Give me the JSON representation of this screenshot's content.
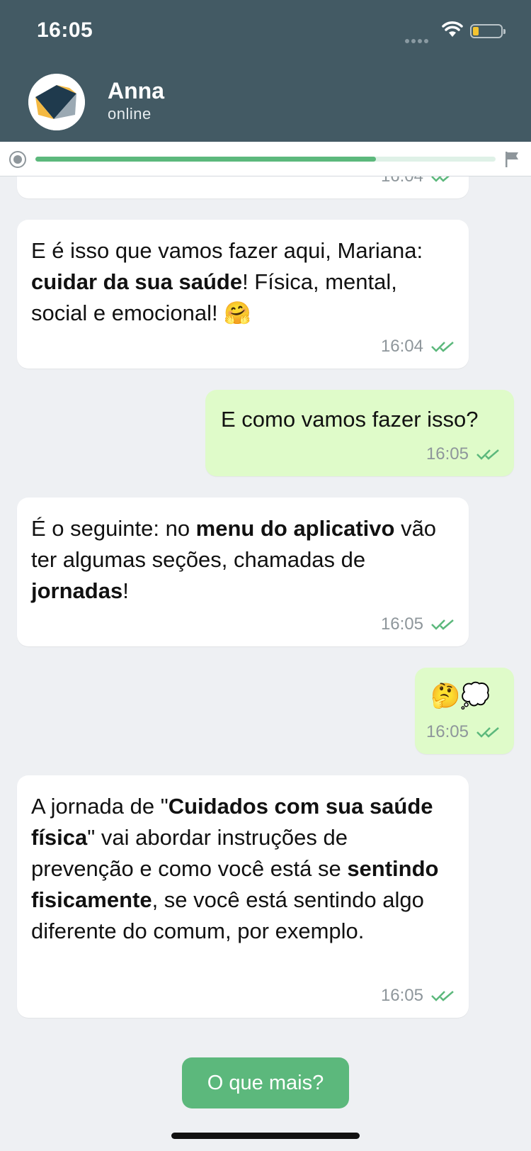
{
  "status_bar": {
    "time": "16:05"
  },
  "contact": {
    "name": "Anna",
    "status": "online"
  },
  "progress": {
    "fraction": 0.74
  },
  "messages": [
    {
      "time": "16:04"
    },
    {
      "parts": [
        {
          "text": "E é isso que vamos fazer aqui, Mariana: ",
          "bold": false
        },
        {
          "text": "cuidar da sua saúde",
          "bold": true
        },
        {
          "text": "! Física, mental, social e emocional! 🤗",
          "bold": false
        }
      ],
      "time": "16:04"
    },
    {
      "text": "E como vamos fazer isso?",
      "time": "16:05"
    },
    {
      "parts": [
        {
          "text": "É o seguinte: no ",
          "bold": false
        },
        {
          "text": "menu do aplicativo",
          "bold": true
        },
        {
          "text": " vão ter algumas seções, chamadas de ",
          "bold": false
        },
        {
          "text": "jornadas",
          "bold": true
        },
        {
          "text": "!",
          "bold": false
        }
      ],
      "time": "16:05"
    },
    {
      "text": "🤔💭",
      "time": "16:05"
    },
    {
      "parts": [
        {
          "text": "A jornada de \"",
          "bold": false
        },
        {
          "text": "Cuidados com sua saúde física",
          "bold": true
        },
        {
          "text": "\" vai abordar instruções de prevenção e como você está se ",
          "bold": false
        },
        {
          "text": "sentindo fisicamente",
          "bold": true
        },
        {
          "text": ", se você está sentindo algo diferente do comum, por exemplo.",
          "bold": false
        }
      ],
      "time": "16:05"
    }
  ],
  "reply_button": {
    "label": "O que mais?"
  },
  "colors": {
    "header": "#435a64",
    "incoming_bubble": "#ffffff",
    "outgoing_bubble": "#dffbc9",
    "accent_green": "#5cb87c",
    "background": "#eef0f3"
  }
}
